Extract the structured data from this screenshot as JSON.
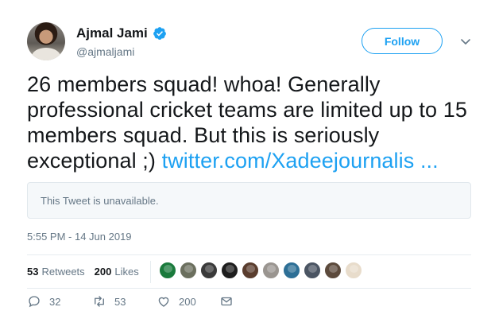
{
  "user": {
    "name": "Ajmal Jami",
    "handle": "@ajmaljami"
  },
  "follow_label": "Follow",
  "tweet": {
    "text": "26 members squad! whoa! Generally professional cricket teams are limited up to 15 members squad. But this is seriously exceptional ;) ",
    "link": "twitter.com/Xadeejournalis ...",
    "quoted_unavailable": "This Tweet is unavailable.",
    "timestamp": "5:55 PM - 14 Jun 2019"
  },
  "stats": {
    "retweets_count": "53",
    "retweets_label": "Retweets",
    "likes_count": "200",
    "likes_label": "Likes"
  },
  "likers": [
    {
      "name": "liker-1",
      "color": "#1a7a3c"
    },
    {
      "name": "liker-2",
      "color": "#6b6f5e"
    },
    {
      "name": "liker-3",
      "color": "#3a3a3a"
    },
    {
      "name": "liker-4",
      "color": "#1e1e1e"
    },
    {
      "name": "liker-5",
      "color": "#5a3d2e"
    },
    {
      "name": "liker-6",
      "color": "#9a9590"
    },
    {
      "name": "liker-7",
      "color": "#2d6f96"
    },
    {
      "name": "liker-8",
      "color": "#4b5563"
    },
    {
      "name": "liker-9",
      "color": "#5c4a3c"
    },
    {
      "name": "liker-10",
      "color": "#e8dccb"
    }
  ],
  "actions": {
    "reply_count": "32",
    "retweet_count": "53",
    "like_count": "200"
  },
  "colors": {
    "accent": "#1da1f2",
    "verified": "#1da1f2",
    "muted": "#657786"
  }
}
